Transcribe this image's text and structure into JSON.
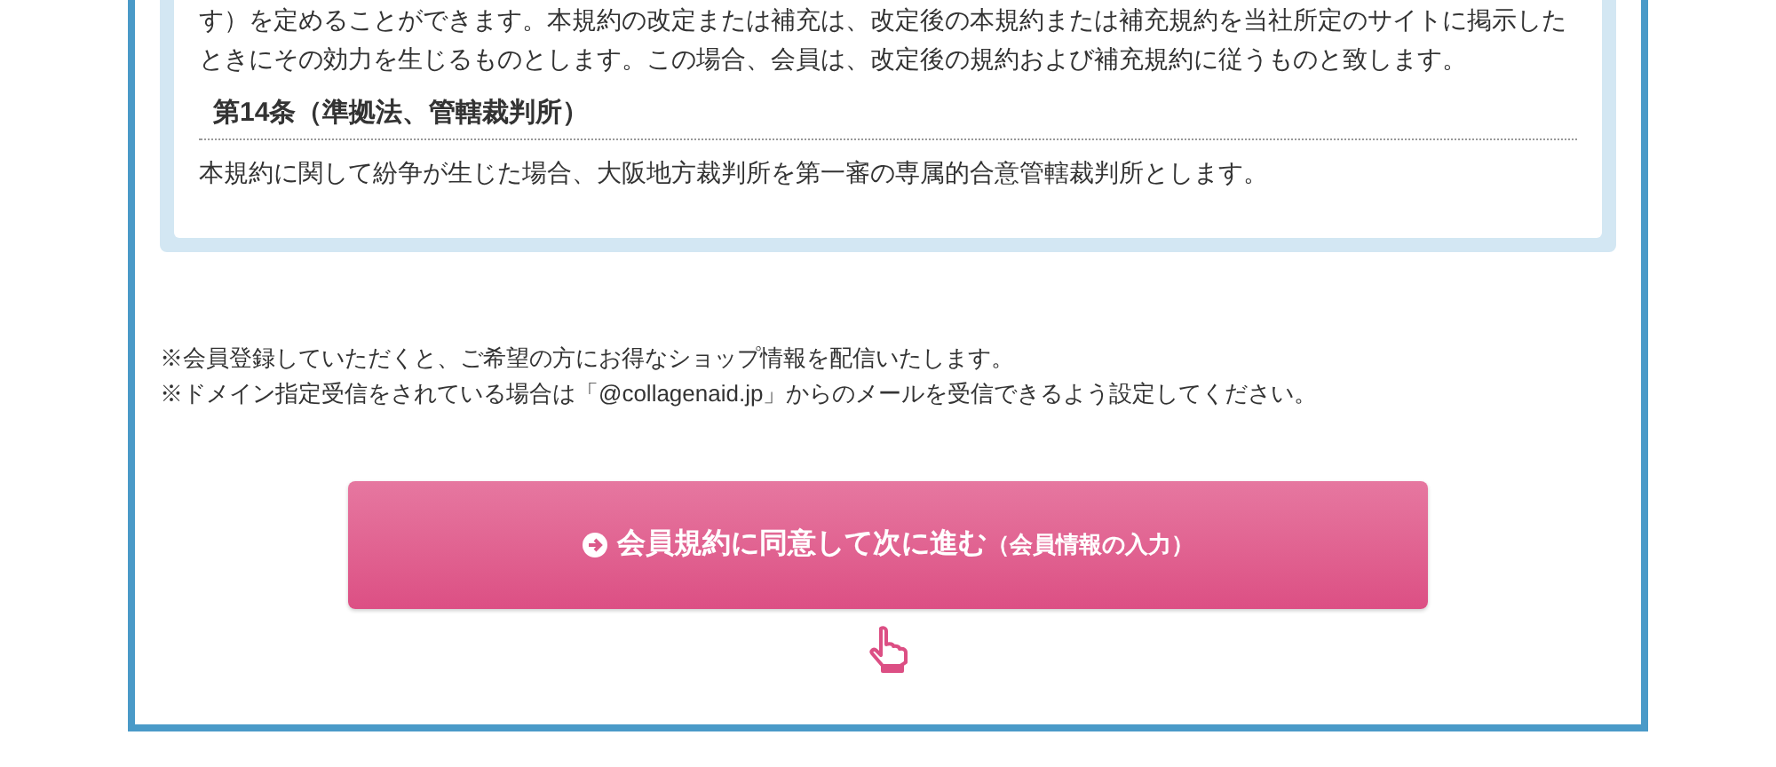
{
  "terms": {
    "paragraph_tail": "す）を定めることができます。本規約の改定または補充は、改定後の本規約または補充規約を当社所定のサイトに掲示したときにその効力を生じるものとします。この場合、会員は、改定後の規約および補充規約に従うものと致します。",
    "article": {
      "heading": "第14条（準拠法、管轄裁判所）",
      "body": "本規約に関して紛争が生じた場合、大阪地方裁判所を第一審の専属的合意管轄裁判所とします。"
    }
  },
  "notes": [
    "※会員登録していただくと、ご希望の方にお得なショップ情報を配信いたします。",
    "※ドメイン指定受信をされている場合は「@collagenaid.jp」からのメールを受信できるよう設定してください。"
  ],
  "agree_button": {
    "label": "会員規約に同意して次に進む",
    "sub_label": "（会員情報の入力）"
  }
}
